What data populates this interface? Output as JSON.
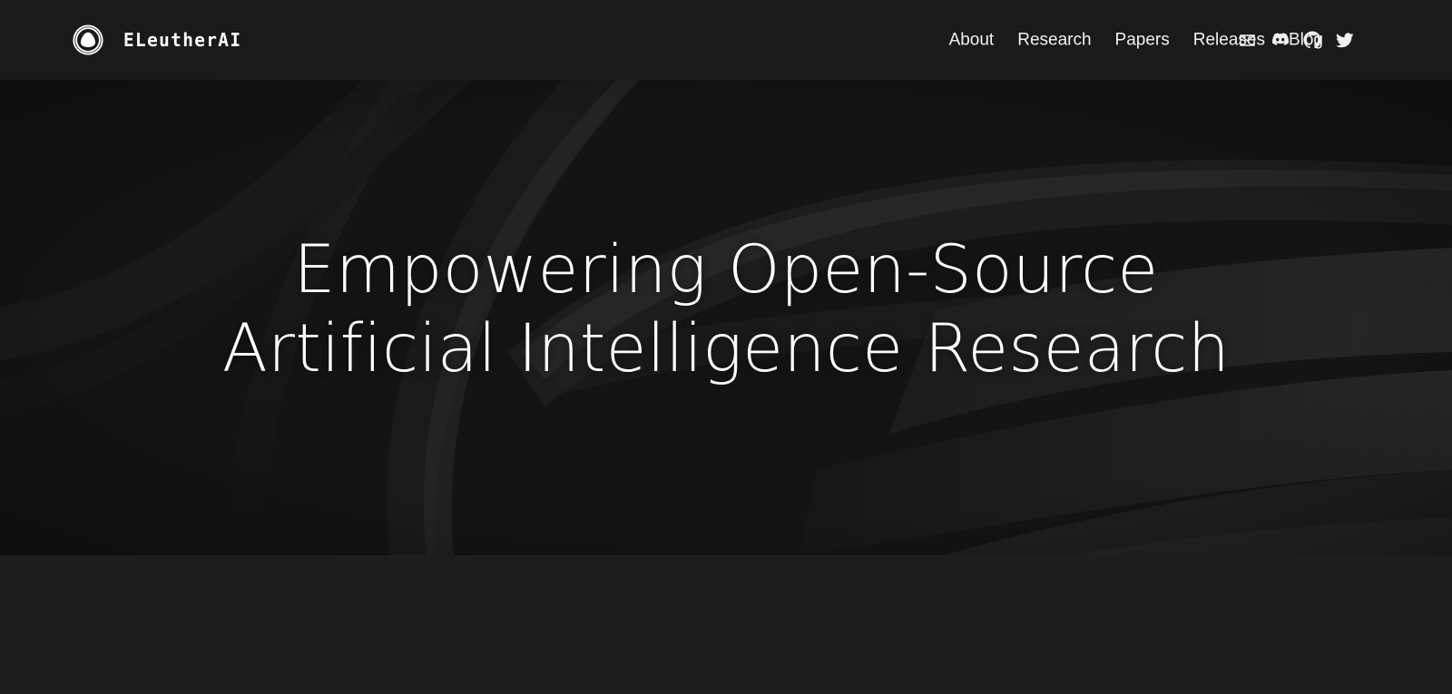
{
  "header": {
    "brand": {
      "logo_icon": "eleutherai-logo-icon",
      "wordmark": "ELeutherAI"
    },
    "nav": [
      {
        "label": "About"
      },
      {
        "label": "Research"
      },
      {
        "label": "Papers"
      },
      {
        "label": "Releases"
      },
      {
        "label": "Blog"
      }
    ],
    "social": [
      {
        "icon": "mail-icon",
        "label": "Email"
      },
      {
        "icon": "discord-icon",
        "label": "Discord"
      },
      {
        "icon": "github-icon",
        "label": "GitHub"
      },
      {
        "icon": "twitter-icon",
        "label": "Twitter"
      }
    ],
    "background_color": "#1a1a1a"
  },
  "hero": {
    "title_line_1": "Empowering Open-Source",
    "title_line_2": "Artificial Intelligence Research",
    "background_color": "#141414",
    "text_color": "#fdfdfd"
  },
  "page": {
    "background_color": "#1d1d1d"
  }
}
